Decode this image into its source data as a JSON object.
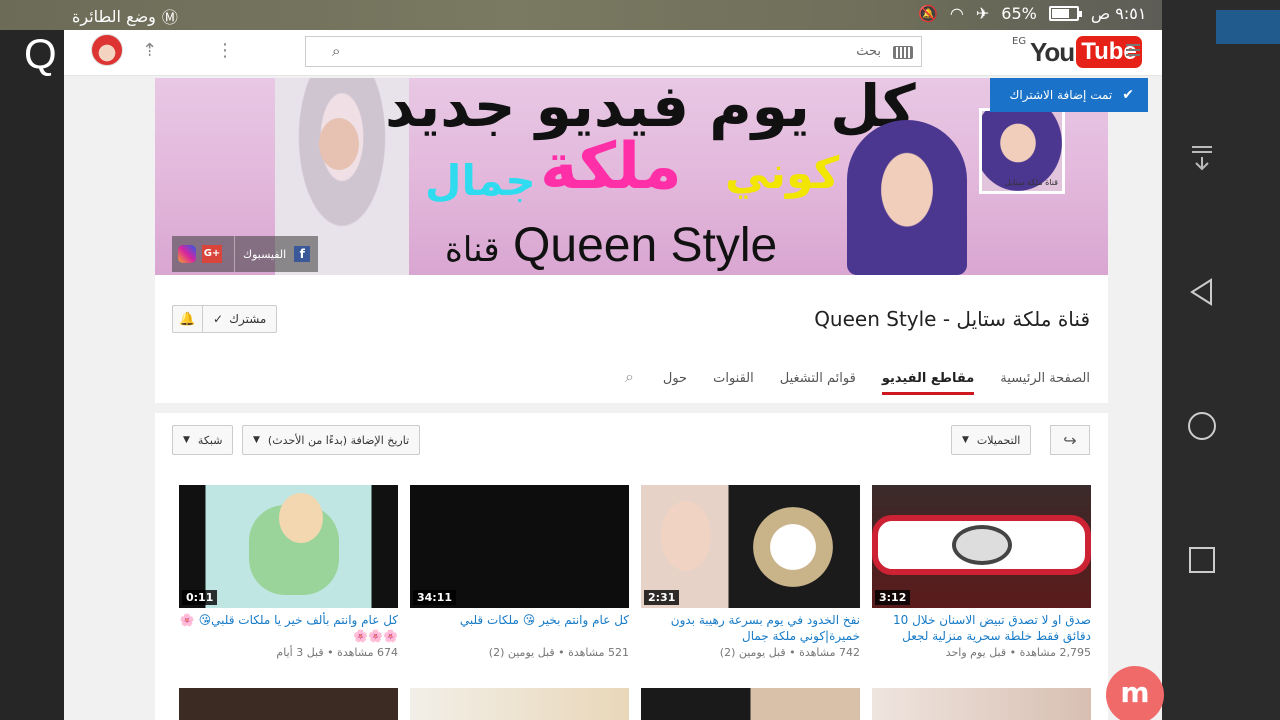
{
  "status_bar": {
    "time": "٩:٥١ ص",
    "battery": "65%",
    "battery_level": 0.65,
    "airplane_label": "وضع الطائرة"
  },
  "left_overlay": {
    "letter": "Q"
  },
  "masthead": {
    "logo_you": "You",
    "logo_tube": "Tube",
    "country": "EG",
    "search_placeholder": "بحث"
  },
  "banner": {
    "line1": "كل يوم فيديو جديد",
    "kuni": "كوني",
    "malika": "ملكة",
    "jamal": "جمال",
    "queen_style": "Queen Style",
    "qanat": "قناة",
    "thumb_label": "قناة ملكة ستايل",
    "facebook_label": "الفيسبوك",
    "gplus": "G+",
    "subscribed_toast": "تمت إضافة الاشتراك"
  },
  "channel": {
    "title": "قناة ملكة ستايل - Queen Style",
    "subscribe_label": "مشترك",
    "tabs": [
      {
        "label": "الصفحة الرئيسية",
        "active": false
      },
      {
        "label": "مقاطع الفيديو",
        "active": true
      },
      {
        "label": "قوائم التشغيل",
        "active": false
      },
      {
        "label": "القنوات",
        "active": false
      },
      {
        "label": "حول",
        "active": false
      }
    ]
  },
  "videos": {
    "uploads_label": "التحميلات",
    "sort_label": "تاريخ الإضافة (بدءًا من الأحدث)",
    "view_label": "شبكة",
    "items": [
      {
        "title": "صدق او لا تصدق تبيض الاسنان خلال 10 دقائق فقط خلطة سحرية منزلية لجعل",
        "views": "2,795 مشاهدة",
        "age": "قبل يوم واحد",
        "duration": "3:12"
      },
      {
        "title": "نفخ الخدود في يوم بسرعة رهيبة بدون خميرة|كوني ملكة جمال",
        "views": "742 مشاهدة",
        "age": "قبل يومين (2)",
        "duration": "2:31"
      },
      {
        "title": "كل عام وانتم بخير 😘 ملكات قلبي",
        "views": "521 مشاهدة",
        "age": "قبل يومين (2)",
        "duration": "34:11"
      },
      {
        "title": "كل عام وانتم بألف خير يا ملكات قلبي😘 🌸🌸🌸🌸",
        "views": "674 مشاهدة",
        "age": "قبل 3 أيام",
        "duration": "0:11"
      }
    ]
  },
  "colors": {
    "accent_red": "#cc181e",
    "link_blue": "#167ac6",
    "toast_blue": "#1a73c8",
    "youtube_red": "#e62117"
  }
}
